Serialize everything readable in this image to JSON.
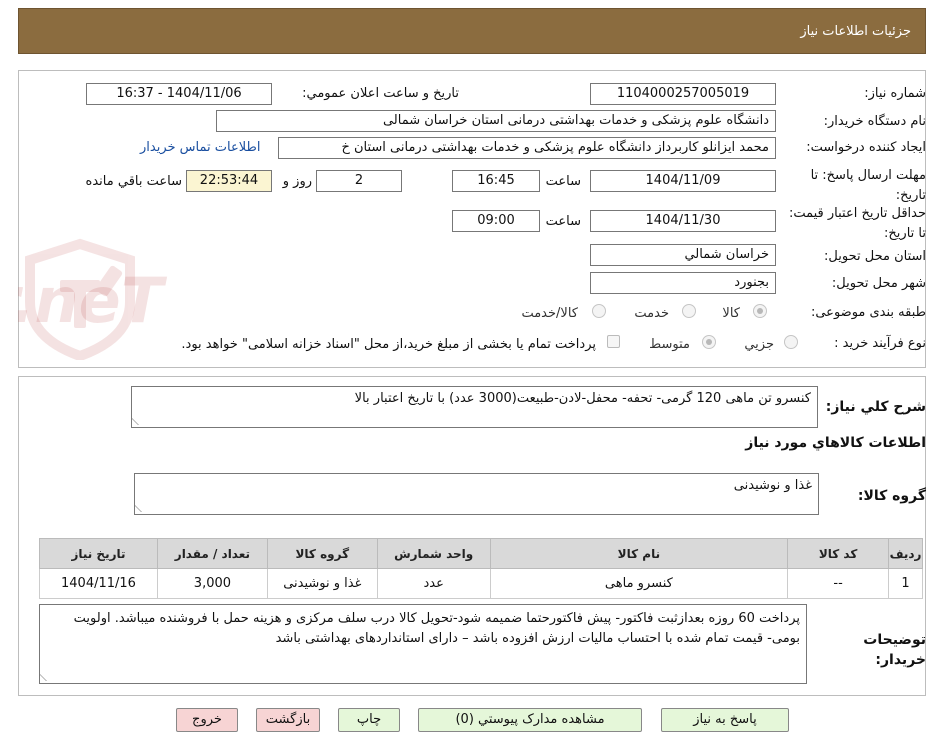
{
  "header": {
    "title": "جزئیات اطلاعات نیاز"
  },
  "form": {
    "need_number_label": "شماره نیاز:",
    "need_number": "1104000257005019",
    "announce_label": "تاریخ و ساعت اعلان عمومي:",
    "announce_value": "1404/11/06 - 16:37",
    "buyer_org_label": "نام دستگاه خريدار:",
    "buyer_org": "دانشگاه علوم پزشکی و خدمات بهداشتی درمانی استان خراسان شمالی",
    "requester_label": "ايجاد کننده درخواست:",
    "requester": "محمد ایزانلو کاربرداز دانشگاه علوم پزشکی و خدمات بهداشتی درمانی استان خ",
    "contact_link": "اطلاعات تماس خريدار",
    "deadline_label": "مهلت ارسال پاسخ: تا تاریخ:",
    "deadline_date": "1404/11/09",
    "time_label": "ساعت",
    "deadline_time": "16:45",
    "days_value": "2",
    "days_label": "روز و",
    "remaining_value": "22:53:44",
    "remaining_label": "ساعت باقي مانده",
    "validity_label": "حداقل تاريخ اعتبار قيمت: تا تاريخ:",
    "validity_date": "1404/11/30",
    "validity_time": "09:00",
    "province_label": "استان محل تحويل:",
    "province": "خراسان شمالي",
    "city_label": "شهر محل تحويل:",
    "city": "بجنورد",
    "category_label": "طبقه بندی موضوعی:",
    "category_options": [
      "کالا",
      "خدمت",
      "کالا/خدمت"
    ],
    "category_selected": "کالا",
    "process_label": "نوع فرآيند خريد :",
    "process_options": [
      "جزیي",
      "متوسط"
    ],
    "process_selected": "متوسط",
    "process_note": "پرداخت تمام يا بخشی از مبلغ خريد،از محل \"اسناد خزانه اسلامی\" خواهد بود."
  },
  "summary": {
    "label": "شرح کلي نياز:",
    "text": "کنسرو تن ماهی 120 گرمی- تحفه- محفل-لادن-طبیعت(3000 عدد) با تاریخ اعتبار بالا"
  },
  "goods": {
    "section_title": "اطلاعات کالاهاي مورد نياز",
    "group_label": "گروه کالا:",
    "group_value": "غذا و نوشيدنی",
    "table_headers": [
      "رديف",
      "کد کالا",
      "نام کالا",
      "واحد شمارش",
      "گروه کالا",
      "تعداد / مقدار",
      "تاريخ نياز"
    ],
    "rows": [
      [
        "1",
        "--",
        "کنسرو ماهی",
        "عدد",
        "غذا و نوشيدنی",
        "3,000",
        "1404/11/16"
      ]
    ]
  },
  "notes": {
    "label": "توضيحات خريدار:",
    "text": "پرداخت 60 روزه بعدازثبت فاکتور- پیش فاکتورحتما ضمیمه شود-تحویل کالا درب سلف مرکزی و هزینه حمل با فروشنده میباشد. اولویت بومی-  قیمت  تمام شده با احتساب مالیات ارزش افزوده باشد – دارای استانداردهای بهداشتی باشد"
  },
  "buttons": {
    "reply": "پاسخ به نياز",
    "attachments": "مشاهده مدارک پيوستي (0)",
    "print": "چاپ",
    "back": "بازگشت",
    "exit": "خروج"
  },
  "watermark": {
    "text": "AriaTender.neT"
  },
  "colors": {
    "header_bg": "#8b6c3f",
    "link": "#1a4fa0",
    "remaining_bg": "#fbf5d2",
    "button_green": "#e5f7d9",
    "button_red": "#f7d4d4"
  }
}
